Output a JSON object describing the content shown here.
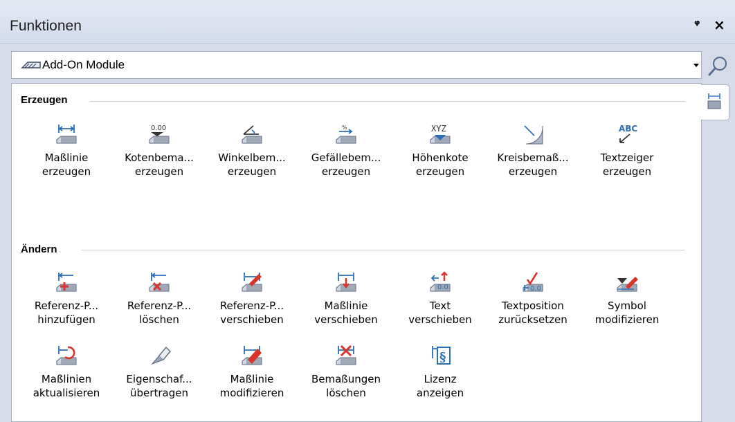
{
  "window": {
    "title": "Funktionen",
    "pin_glyph": "ᵠ",
    "close_glyph": "×"
  },
  "dropdown": {
    "selected": "Add-On Module",
    "icon": "add-on-module-icon"
  },
  "search": {
    "icon": "magnifier-icon"
  },
  "sidetab": {
    "icon": "dimension-tab-icon"
  },
  "sections": {
    "erzeugen": {
      "title": "Erzeugen",
      "tools": [
        {
          "line1": "Maßlinie",
          "line2": "erzeugen",
          "icon": "dimension-line-icon"
        },
        {
          "line1": "Kotenbema...",
          "line2": "erzeugen",
          "icon": "elevation-dimension-icon"
        },
        {
          "line1": "Winkelbem...",
          "line2": "erzeugen",
          "icon": "angle-dimension-icon"
        },
        {
          "line1": "Gefällebem...",
          "line2": "erzeugen",
          "icon": "slope-dimension-icon"
        },
        {
          "line1": "Höhenkote",
          "line2": "erzeugen",
          "icon": "height-marker-icon"
        },
        {
          "line1": "Kreisbemaß...",
          "line2": "erzeugen",
          "icon": "circle-dimension-icon"
        },
        {
          "line1": "Textzeiger",
          "line2": "erzeugen",
          "icon": "text-pointer-icon"
        }
      ]
    },
    "aendern": {
      "title": "Ändern",
      "tools": [
        {
          "line1": "Referenz-P...",
          "line2": "hinzufügen",
          "icon": "add-reference-point-icon"
        },
        {
          "line1": "Referenz-P...",
          "line2": "löschen",
          "icon": "delete-reference-point-icon"
        },
        {
          "line1": "Referenz-P...",
          "line2": "verschieben",
          "icon": "move-reference-point-icon"
        },
        {
          "line1": "Maßlinie",
          "line2": "verschieben",
          "icon": "move-dimension-line-icon"
        },
        {
          "line1": "Text",
          "line2": "verschieben",
          "icon": "move-text-icon"
        },
        {
          "line1": "Textposition",
          "line2": "zurücksetzen",
          "icon": "reset-text-position-icon"
        },
        {
          "line1": "Symbol",
          "line2": "modifizieren",
          "icon": "modify-symbol-icon"
        },
        {
          "line1": "Maßlinien",
          "line2": "aktualisieren",
          "icon": "update-dimension-lines-icon"
        },
        {
          "line1": "Eigenschaf...",
          "line2": "übertragen",
          "icon": "transfer-properties-icon"
        },
        {
          "line1": "Maßlinie",
          "line2": "modifizieren",
          "icon": "modify-dimension-line-icon"
        },
        {
          "line1": "Bemaßungen",
          "line2": "löschen",
          "icon": "delete-dimensions-icon"
        },
        {
          "line1": "Lizenz",
          "line2": "anzeigen",
          "icon": "license-icon"
        }
      ]
    }
  },
  "colors": {
    "panel_bg": "#d6dbe9",
    "icon_blue": "#2a6fb8",
    "icon_red": "#d9342b",
    "block_gray": "#7a8596"
  }
}
